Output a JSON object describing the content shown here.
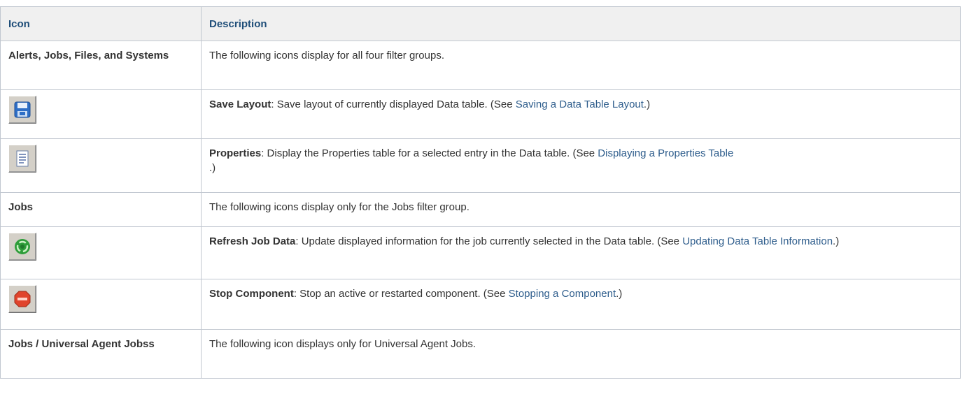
{
  "header": {
    "icon": "Icon",
    "description": "Description"
  },
  "rows": [
    {
      "type": "category",
      "label": "Alerts, Jobs, Files, and Systems",
      "text": "The following icons display for all four filter groups."
    },
    {
      "type": "icon",
      "icon": "save-disk-icon",
      "term": "Save Layout",
      "before": ": Save layout of currently displayed Data table. (See ",
      "link": "Saving a Data Table Layout",
      "after": ".)"
    },
    {
      "type": "icon",
      "icon": "properties-document-icon",
      "term": "Properties",
      "before": ": Display the Properties table for a selected entry in the Data table. (See ",
      "link": "Displaying a Properties Table",
      "after": ".)"
    },
    {
      "type": "category",
      "label": "Jobs",
      "text": "The following icons display only for the Jobs filter group."
    },
    {
      "type": "icon",
      "icon": "refresh-recycle-icon",
      "term": "Refresh Job Data",
      "before": ": Update displayed information for the job currently selected in the Data table. (See ",
      "link": "Updating Data Table Information",
      "after": ".)"
    },
    {
      "type": "icon",
      "icon": "stop-sign-icon",
      "term": "Stop Component",
      "before": ": Stop an active or restarted component. (See ",
      "link": "Stopping a Component",
      "after": ".)"
    },
    {
      "type": "category",
      "label": "Jobs / Universal Agent Jobss",
      "text": "The following icon displays only for Universal Agent Jobs."
    }
  ]
}
